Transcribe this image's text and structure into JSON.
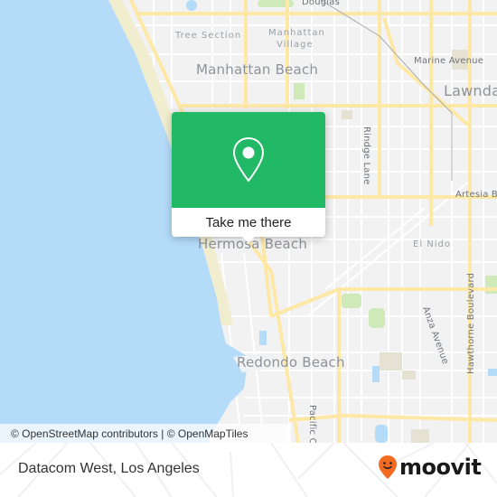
{
  "map": {
    "colors": {
      "water": "#b4dcf9",
      "land": "#f2f2f2",
      "beach": "#f1edcf",
      "major_road": "#fde8a6",
      "minor_road": "#ffffff",
      "park": "#cfe9b8",
      "builtup": "#e6e2d3"
    },
    "labels": {
      "city_manhattan_beach": "Manhattan Beach",
      "city_hermosa_beach": "Hermosa Beach",
      "city_redondo_beach": "Redondo Beach",
      "city_lawndale": "Lawndal",
      "hood_tree_section": "Tree Section",
      "hood_manhattan_village_1": "Manhattan",
      "hood_manhattan_village_2": "Village",
      "hood_el_nido": "El Nido",
      "street_douglas": "Douglas",
      "street_marine_avenue": "Marine Avenue",
      "street_artesia": "Artesia B",
      "street_rindge_lane": "Rindge Lane",
      "street_anza_avenue": "Anza Avenue",
      "street_hawthorne_boulevard": "Hawthorne Boulevard",
      "street_pacific": "Pacific C"
    }
  },
  "popup": {
    "icon": "map-pin-icon",
    "button_label": "Take me there",
    "color": "#21b866"
  },
  "attribution": "© OpenStreetMap contributors | © OpenMapTiles",
  "footer": {
    "location_title": "Datacom West, Los Angeles",
    "logo_text": "moovit",
    "logo_icon": "moovit-pin-icon",
    "logo_color": "#f26b21"
  }
}
